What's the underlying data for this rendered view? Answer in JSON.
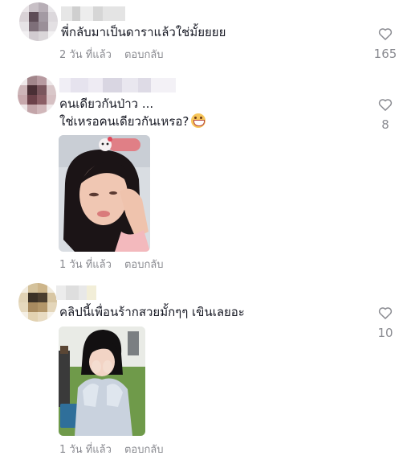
{
  "comments": [
    {
      "text_lines": [
        "พี่กลับมาเป็นดาราแล้วใช่มั้ยยยย"
      ],
      "time": "2 วัน ที่แล้ว",
      "reply_label": "ตอบกลับ",
      "likes": "165",
      "icons": {
        "like": "heart-outline-icon"
      }
    },
    {
      "text_lines": [
        "คนเดียวกันป่าว ...",
        "ใช่เหรอคนเดียวกันเหรอ?"
      ],
      "emoji": "grimacing-face",
      "photo_label": "selfie-girl-with-hair-clip",
      "time": "1 วัน ที่แล้ว",
      "reply_label": "ตอบกลับ",
      "likes": "8",
      "icons": {
        "like": "heart-outline-icon"
      }
    },
    {
      "text_lines": [
        "คลิปนี้เพื่อนร้ากสวยมั้กๆๆ เขินเลยอะ"
      ],
      "photo_label": "girl-sitting-outdoors-covering-face",
      "time": "1 วัน ที่แล้ว",
      "reply_label": "ตอบกลับ",
      "likes": "10",
      "icons": {
        "like": "heart-outline-icon"
      }
    }
  ],
  "colors": {
    "text": "#161823",
    "muted": "#8a8b91",
    "heart": "#8a8b91"
  }
}
